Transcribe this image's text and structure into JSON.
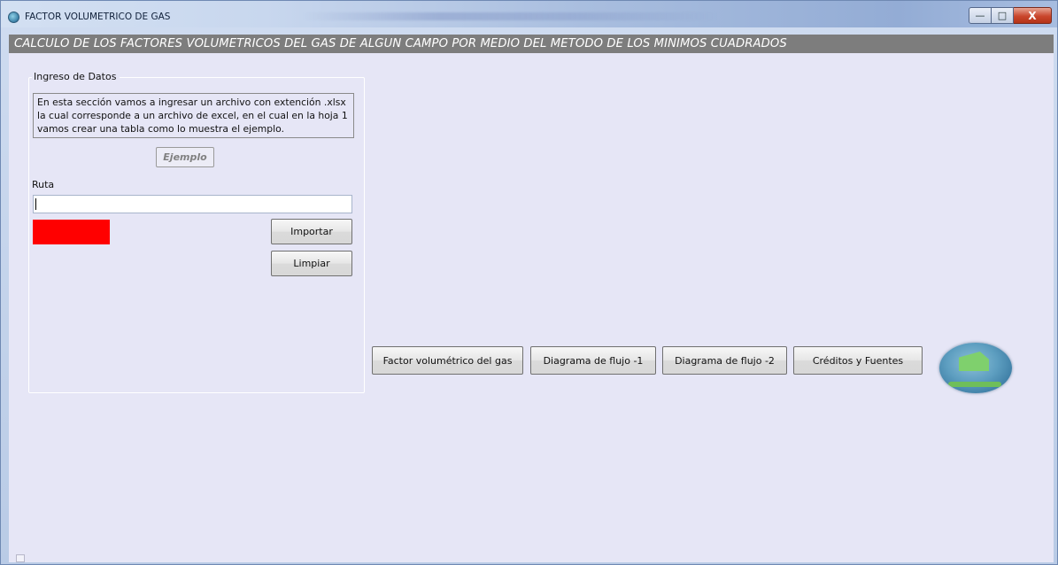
{
  "window": {
    "title": "FACTOR VOLUMETRICO DE GAS",
    "controls": {
      "minimize": "—",
      "maximize": "□",
      "close": "X"
    }
  },
  "banner": {
    "text": "CALCULO DE LOS FACTORES VOLUMETRICOS DEL GAS DE ALGUN CAMPO POR MEDIO DEL METODO DE LOS MINIMOS CUADRADOS"
  },
  "data_entry": {
    "group_label": "Ingreso de Datos",
    "description_lines": [
      "En esta sección vamos a ingresar un archivo con extención .xlsx",
      "la cual corresponde a un archivo de excel, en el cual en la hoja 1",
      "vamos crear una  tabla como lo muestra el ejemplo."
    ],
    "example_button": "Ejemplo",
    "path_label": "Ruta",
    "path_value": "",
    "status_color": "#ff0000",
    "import_button": "Importar",
    "clear_button": "Limpiar"
  },
  "actions": {
    "factor_button": "Factor volumétrico del gas",
    "flow_diagram_1_button": "Diagrama de flujo -1",
    "flow_diagram_2_button": "Diagrama de flujo -2",
    "credits_button": "Créditos y Fuentes"
  },
  "logo": {
    "icon": "school-logo-icon"
  }
}
